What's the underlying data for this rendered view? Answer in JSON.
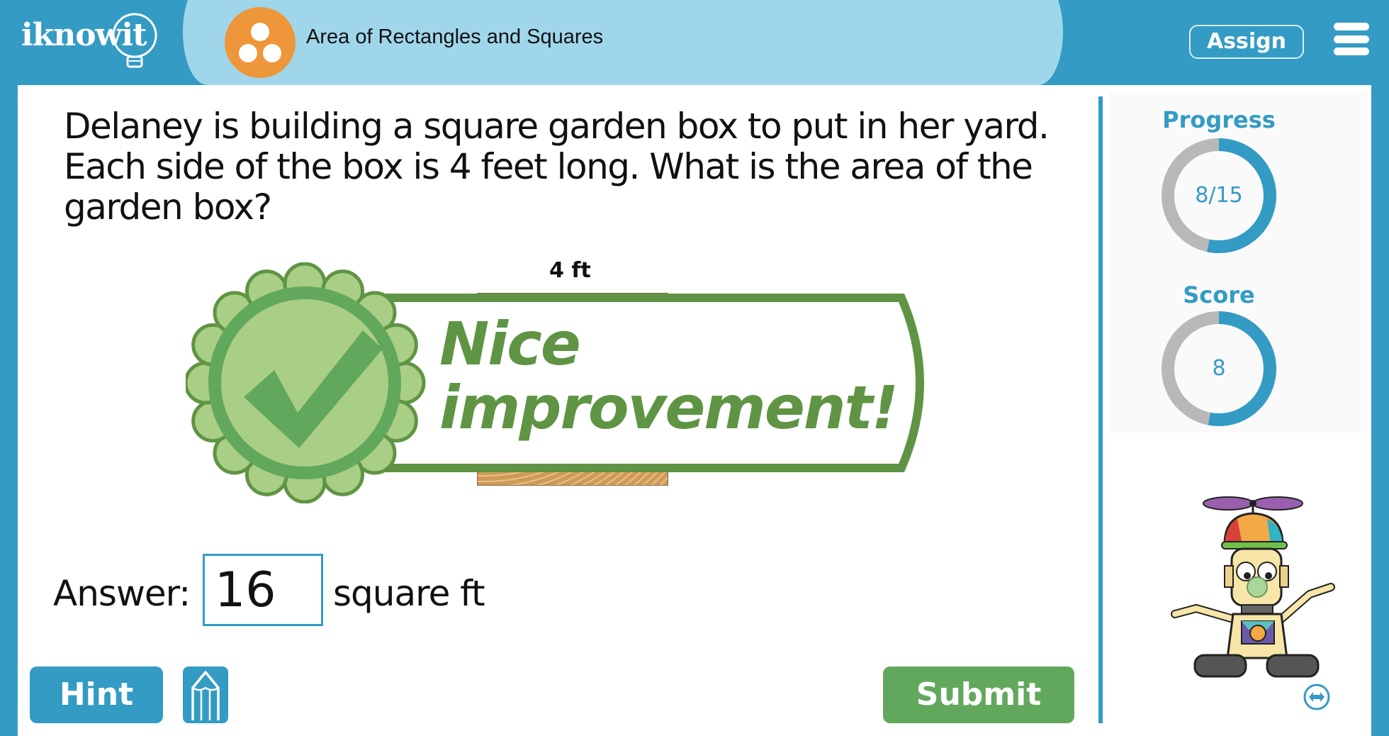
{
  "header": {
    "logo_text": "iknowit",
    "topic_title": "Area of Rectangles and Squares",
    "assign_label": "Assign",
    "menu_icon": "hamburger-menu-icon",
    "topic_icon": "three-dots-circle-icon"
  },
  "question": {
    "text": "Delaney is building a square garden box to put in her yard. Each side of the box is 4 feet long. What is the area of the garden box?",
    "figure_label": "4 ft"
  },
  "feedback": {
    "line1": "Nice",
    "line2": "improvement!",
    "icon": "checkmark-rosette-icon"
  },
  "answer": {
    "label": "Answer:",
    "value": "16",
    "unit": "square ft"
  },
  "buttons": {
    "hint": "Hint",
    "pencil_icon": "pencil-icon",
    "submit": "Submit"
  },
  "stats": {
    "progress_label": "Progress",
    "progress_text": "8/15",
    "progress_current": 8,
    "progress_total": 15,
    "score_label": "Score",
    "score_text": "8",
    "score_fraction": 0.53
  },
  "colors": {
    "brand_blue": "#339bc4",
    "band_light_blue": "#9fd6ea",
    "topic_orange": "#ee963a",
    "success_green": "#62a85c",
    "badge_green": "#5f9444",
    "ring_gray": "#b8b8b8"
  },
  "mascot": {
    "icon": "robot-mascot-icon"
  },
  "swap_icon": "swap-arrows-icon"
}
